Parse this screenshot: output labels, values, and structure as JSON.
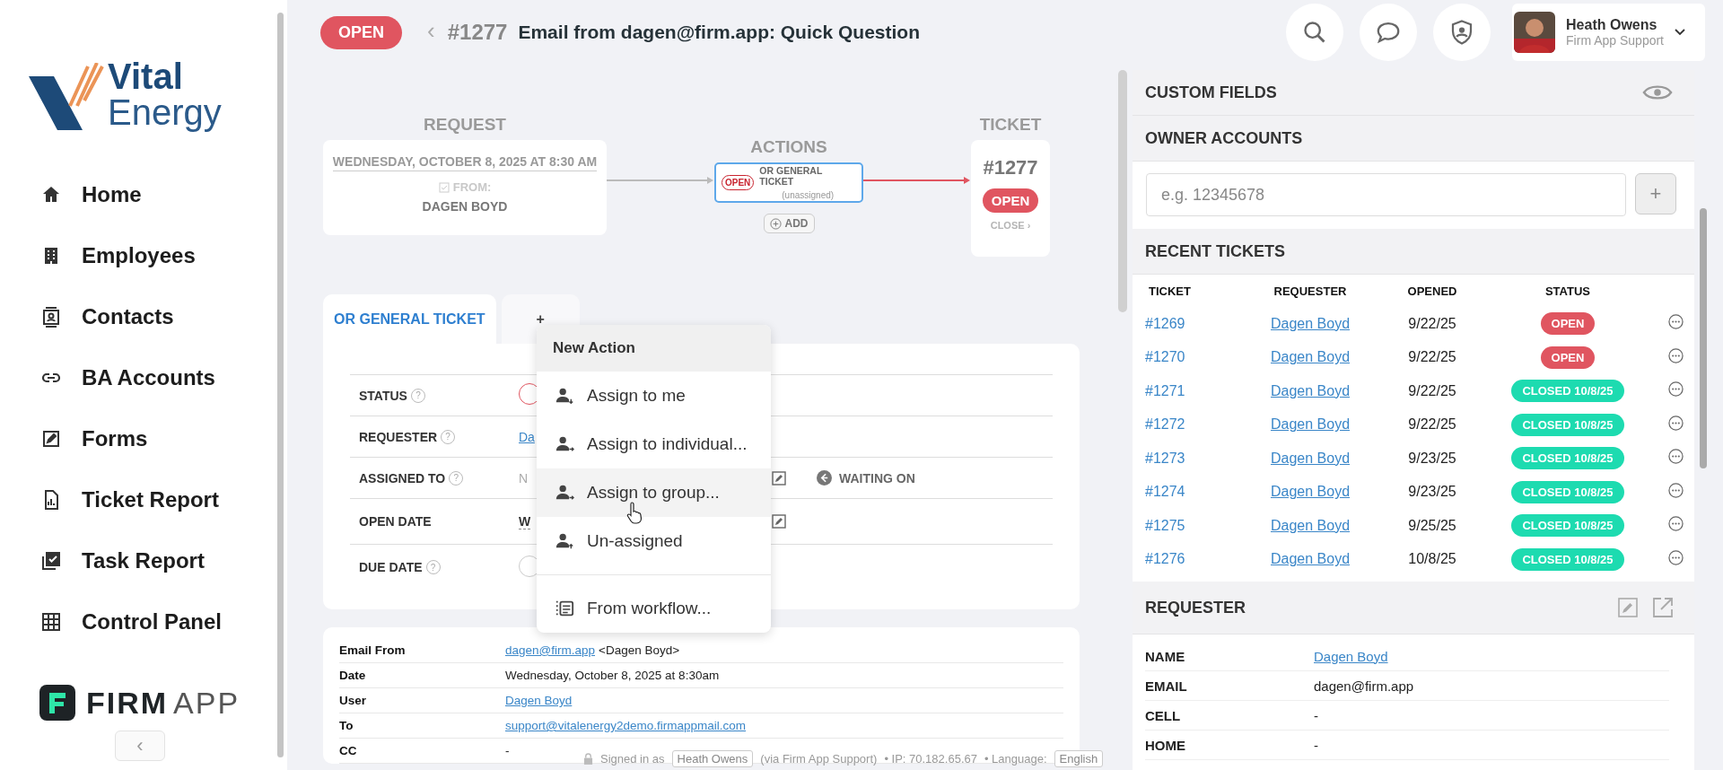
{
  "brand": {
    "line1": "Vital",
    "line2": "Energy"
  },
  "nav": [
    {
      "label": "Home"
    },
    {
      "label": "Employees"
    },
    {
      "label": "Contacts"
    },
    {
      "label": "BA Accounts"
    },
    {
      "label": "Forms"
    },
    {
      "label": "Ticket Report"
    },
    {
      "label": "Task Report"
    },
    {
      "label": "Control Panel"
    }
  ],
  "vendor_logo": {
    "bold": "FIRM",
    "light": "APP"
  },
  "collapse": "‹",
  "header": {
    "status": "OPEN",
    "back": "‹",
    "number": "#1277",
    "subject": "Email from dagen@firm.app: Quick Question",
    "user_name": "Heath Owens",
    "user_role": "Firm App Support"
  },
  "flow": {
    "request": {
      "label": "REQUEST",
      "date": "WEDNESDAY, OCTOBER 8, 2025 AT 8:30 AM",
      "from_label": "FROM:",
      "from": "DAGEN BOYD"
    },
    "actions": {
      "label": "ACTIONS",
      "status": "OPEN",
      "name": "OR GENERAL TICKET",
      "assignee": "(unassigned)",
      "add": "ADD"
    },
    "ticket": {
      "label": "TICKET",
      "number": "#1277",
      "status": "OPEN",
      "close": "CLOSE ›"
    }
  },
  "tabs": [
    {
      "label": "OR GENERAL TICKET",
      "selected": true
    },
    {
      "label": "+",
      "selected": false
    }
  ],
  "form_rows": [
    {
      "label": "STATUS",
      "help": "?",
      "kind": "badge",
      "editable": false
    },
    {
      "label": "REQUESTER",
      "help": "?",
      "kind": "link",
      "value": "Da",
      "editable": false
    },
    {
      "label": "ASSIGNED TO",
      "help": "?",
      "kind": "muted",
      "value": "N",
      "editable": true,
      "waiting_on": "WAITING ON"
    },
    {
      "label": "OPEN DATE",
      "kind": "text",
      "value": "W",
      "editable": true
    },
    {
      "label": "DUE DATE",
      "help": "?",
      "kind": "empty",
      "editable": false
    }
  ],
  "menu": {
    "title": "New Action",
    "groups": [
      [
        {
          "label": "Assign to me",
          "selected": false
        },
        {
          "label": "Assign to individual...",
          "selected": false
        },
        {
          "label": "Assign to group...",
          "selected": true
        },
        {
          "label": "Un-assigned",
          "selected": false
        }
      ],
      [
        {
          "label": "From workflow...",
          "selected": false
        }
      ]
    ]
  },
  "email": [
    {
      "label": "Email From",
      "link": "dagen@firm.app",
      "text": "<Dagen Boyd>"
    },
    {
      "label": "Date",
      "text": "Wednesday, October 8, 2025 at 8:30am"
    },
    {
      "label": "User",
      "link": "Dagen Boyd"
    },
    {
      "label": "To",
      "link": "support@vitalenergy2demo.firmappmail.com"
    },
    {
      "label": "CC",
      "text": "-"
    }
  ],
  "footer": {
    "signed_in": "Signed in as",
    "user": "Heath Owens",
    "via": "(via Firm App Support)",
    "ip": "• IP: 70.182.65.67",
    "language_label": "• Language:",
    "language": "English"
  },
  "custom_fields": {
    "title": "CUSTOM FIELDS"
  },
  "owner_accounts": {
    "title": "OWNER ACCOUNTS",
    "placeholder": "e.g. 12345678",
    "add": "+"
  },
  "recent_tickets": {
    "title": "RECENT TICKETS",
    "columns": [
      "TICKET",
      "REQUESTER",
      "OPENED",
      "STATUS"
    ],
    "rows": [
      {
        "ticket": "#1269",
        "requester": "Dagen Boyd",
        "opened": "9/22/25",
        "status": "OPEN",
        "kind": "open"
      },
      {
        "ticket": "#1270",
        "requester": "Dagen Boyd",
        "opened": "9/22/25",
        "status": "OPEN",
        "kind": "open"
      },
      {
        "ticket": "#1271",
        "requester": "Dagen Boyd",
        "opened": "9/22/25",
        "status": "CLOSED 10/8/25",
        "kind": "closed"
      },
      {
        "ticket": "#1272",
        "requester": "Dagen Boyd",
        "opened": "9/22/25",
        "status": "CLOSED 10/8/25",
        "kind": "closed"
      },
      {
        "ticket": "#1273",
        "requester": "Dagen Boyd",
        "opened": "9/23/25",
        "status": "CLOSED 10/8/25",
        "kind": "closed"
      },
      {
        "ticket": "#1274",
        "requester": "Dagen Boyd",
        "opened": "9/23/25",
        "status": "CLOSED 10/8/25",
        "kind": "closed"
      },
      {
        "ticket": "#1275",
        "requester": "Dagen Boyd",
        "opened": "9/25/25",
        "status": "CLOSED 10/8/25",
        "kind": "closed"
      },
      {
        "ticket": "#1276",
        "requester": "Dagen Boyd",
        "opened": "10/8/25",
        "status": "CLOSED 10/8/25",
        "kind": "closed"
      }
    ]
  },
  "requester": {
    "title": "REQUESTER",
    "rows": [
      {
        "label": "NAME",
        "value": "Dagen Boyd",
        "link": true
      },
      {
        "label": "EMAIL",
        "value": "dagen@firm.app",
        "link": false
      },
      {
        "label": "CELL",
        "value": "-",
        "link": false
      },
      {
        "label": "HOME",
        "value": "-",
        "link": false
      }
    ]
  }
}
